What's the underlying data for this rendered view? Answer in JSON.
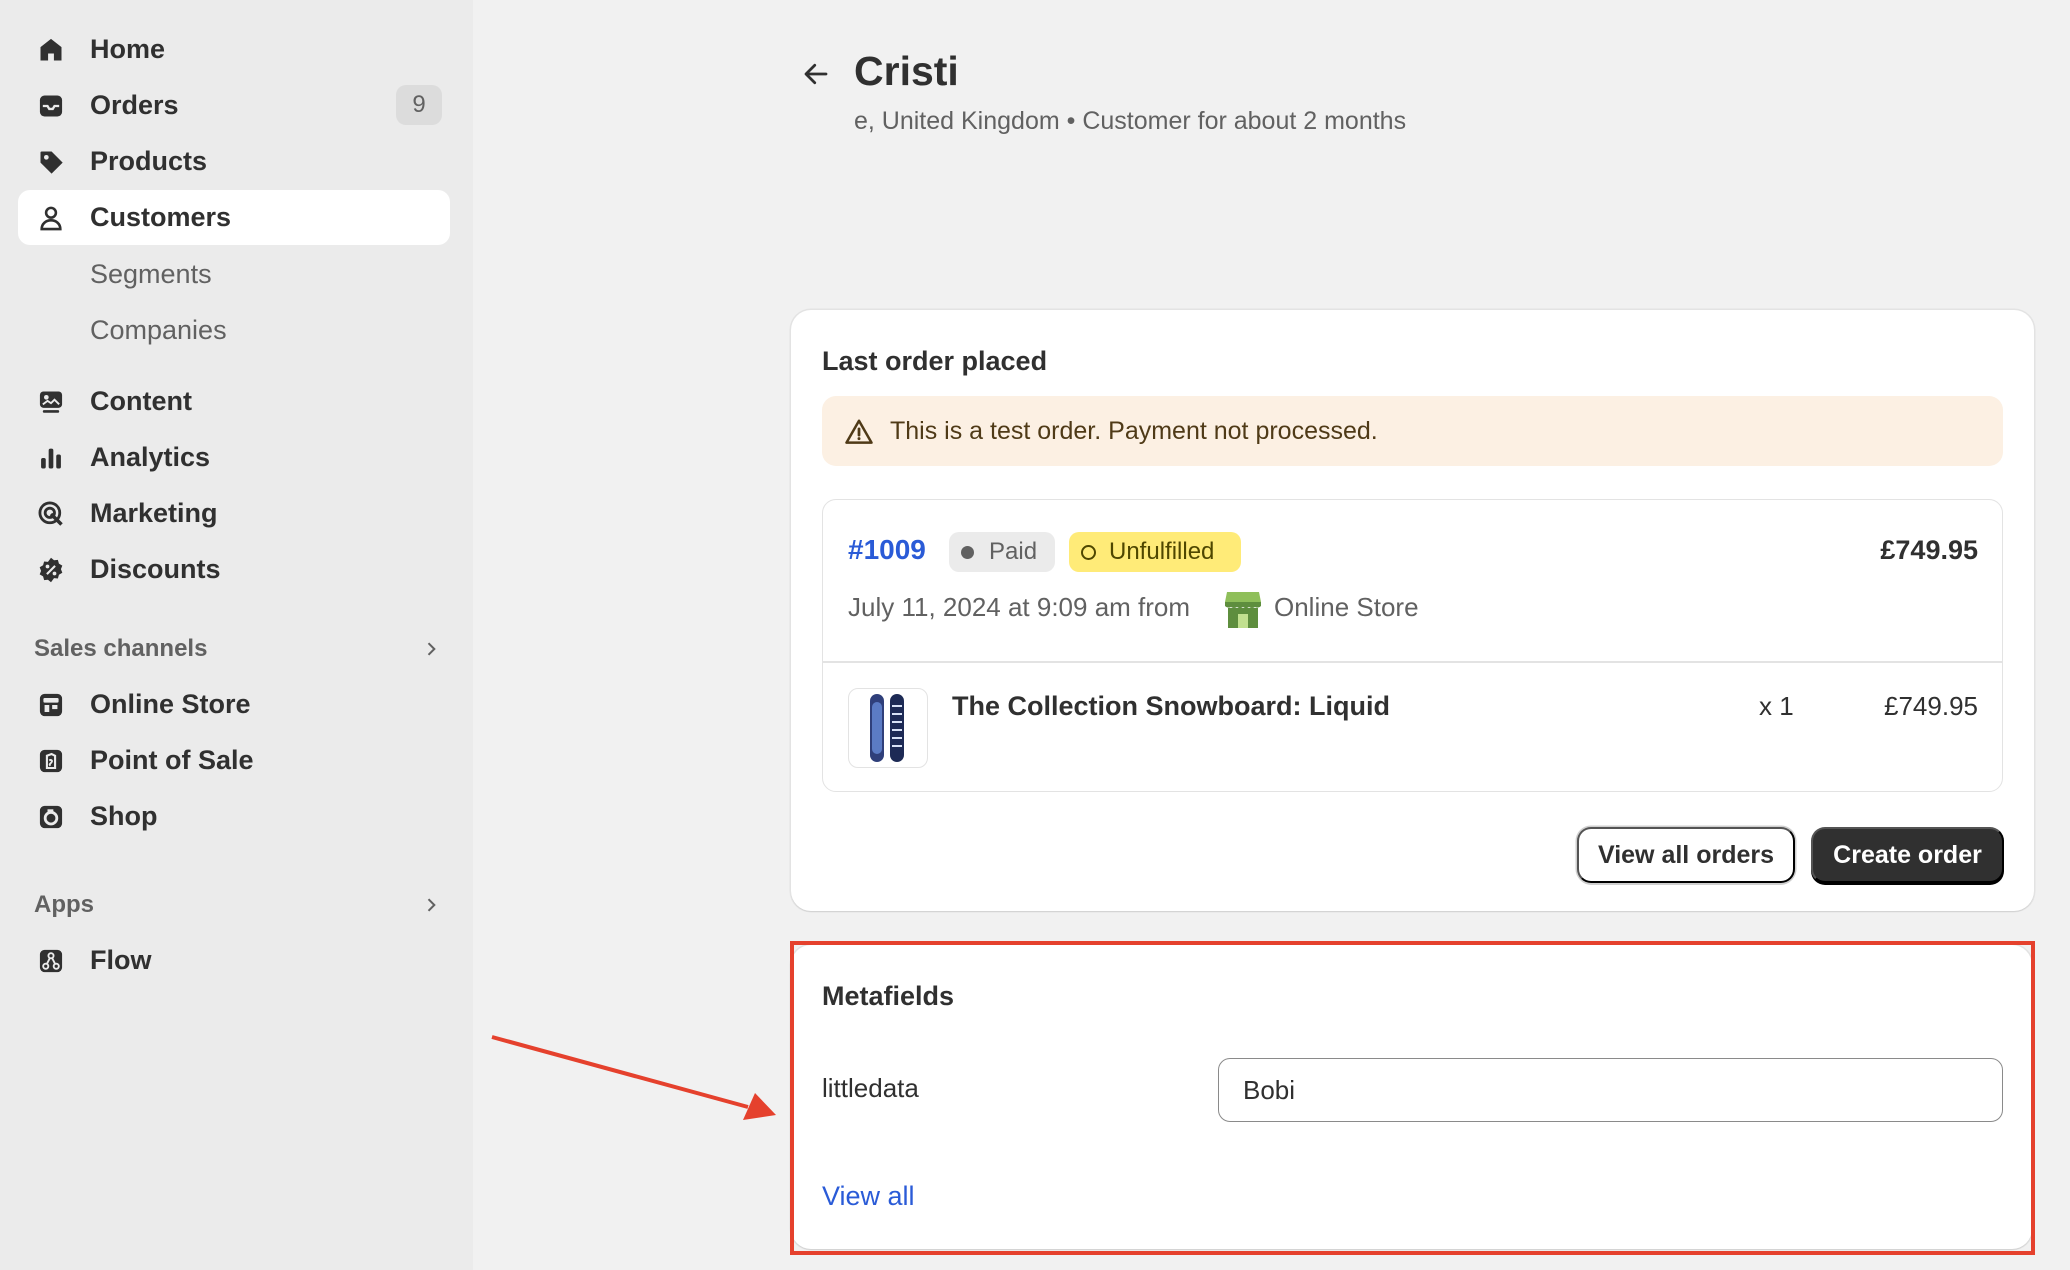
{
  "sidebar": {
    "nav": [
      {
        "label": "Home",
        "icon": "home-icon"
      },
      {
        "label": "Orders",
        "icon": "orders-icon",
        "badge": "9"
      },
      {
        "label": "Products",
        "icon": "tag-icon"
      },
      {
        "label": "Customers",
        "icon": "person-icon",
        "active": true
      }
    ],
    "customers_sub": [
      "Segments",
      "Companies"
    ],
    "nav2": [
      {
        "label": "Content",
        "icon": "content-icon"
      },
      {
        "label": "Analytics",
        "icon": "bar-chart-icon"
      },
      {
        "label": "Marketing",
        "icon": "target-icon"
      },
      {
        "label": "Discounts",
        "icon": "discount-icon"
      }
    ],
    "sales_channels": {
      "heading": "Sales channels",
      "items": [
        {
          "label": "Online Store",
          "icon": "store-icon"
        },
        {
          "label": "Point of Sale",
          "icon": "pos-icon"
        },
        {
          "label": "Shop",
          "icon": "shop-icon"
        }
      ]
    },
    "apps": {
      "heading": "Apps",
      "items": [
        {
          "label": "Flow",
          "icon": "flow-icon"
        }
      ]
    }
  },
  "header": {
    "title": "Cristi",
    "subtitle": "e, United Kingdom • Customer for about 2 months"
  },
  "last_order": {
    "title": "Last order placed",
    "banner": "This is a test order. Payment not processed.",
    "order_number": "#1009",
    "payment_status": "Paid",
    "fulfillment_status": "Unfulfilled",
    "total": "£749.95",
    "date": "July 11, 2024 at 9:09 am from",
    "channel": "Online Store",
    "line_item": {
      "name": "The Collection Snowboard: Liquid",
      "qty": "x 1",
      "price": "£749.95"
    },
    "view_all_label": "View all orders",
    "create_label": "Create order"
  },
  "metafields": {
    "title": "Metafields",
    "fields": [
      {
        "label": "littledata",
        "value": "Bobi"
      }
    ],
    "view_all_label": "View all"
  },
  "colors": {
    "accent_link": "#2a5bd7",
    "annotation": "#e5412d",
    "unfulfilled_badge": "#ffeb78",
    "banner_bg": "#fcf0e3"
  }
}
